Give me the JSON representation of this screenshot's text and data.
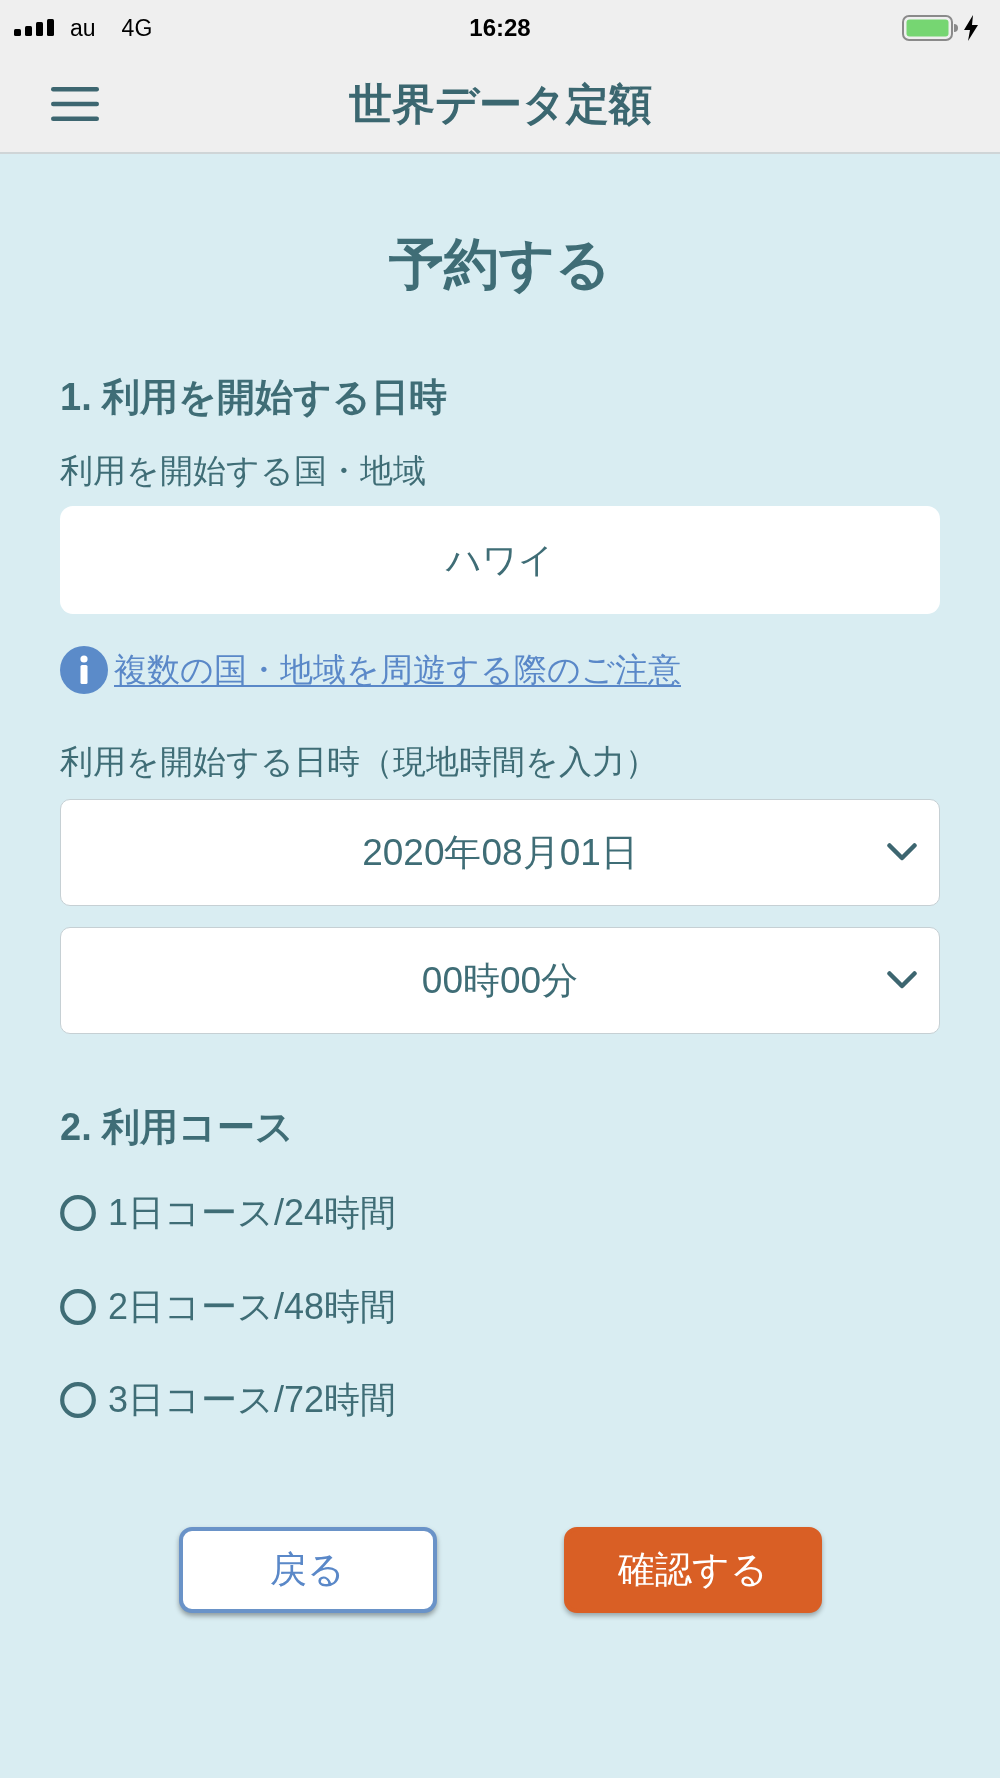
{
  "status_bar": {
    "carrier": "au",
    "network": "4G",
    "time": "16:28"
  },
  "header": {
    "title": "世界データ定額"
  },
  "page_title": "予約する",
  "start_section": {
    "heading": "1. 利用を開始する日時",
    "country": {
      "label": "利用を開始する国・地域",
      "value": "ハワイ"
    },
    "notice_link": "複数の国・地域を周遊する際のご注意",
    "datetime": {
      "label": "利用を開始する日時（現地時間を入力）",
      "selects": [
        {
          "value": "2020年08月01日"
        },
        {
          "value": "00時00分"
        }
      ]
    }
  },
  "course_section": {
    "heading": "2. 利用コース",
    "options": [
      {
        "label": "1日コース/24時間",
        "selected": false
      },
      {
        "label": "2日コース/48時間",
        "selected": false
      },
      {
        "label": "3日コース/72時間",
        "selected": false
      }
    ]
  },
  "buttons": [
    {
      "label": "戻る",
      "kind": "secondary"
    },
    {
      "label": "確認する",
      "kind": "primary"
    }
  ]
}
